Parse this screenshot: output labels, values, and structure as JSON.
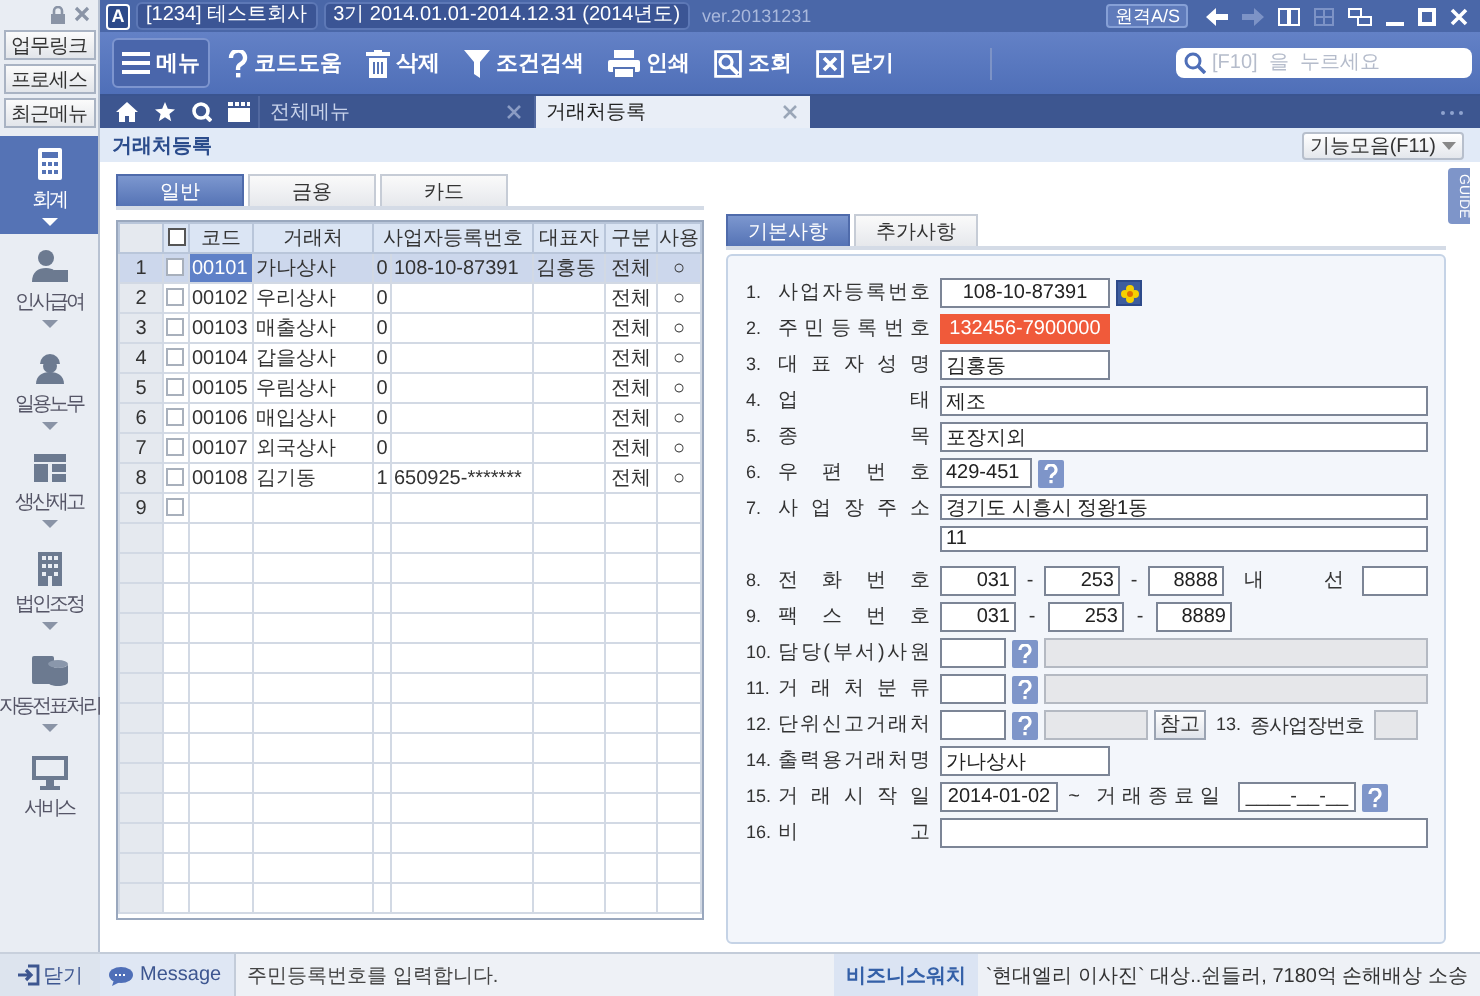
{
  "title_bar": {
    "app_icon": "A",
    "company": "[1234] 테스트회사",
    "period": "3기  2014.01.01-2014.12.31  (2014년도)",
    "version": "ver.20131231",
    "remote_button": "원격A/S"
  },
  "sidebar": {
    "quick_buttons": [
      "업무링크",
      "프로세스",
      "최근메뉴"
    ],
    "modules": [
      {
        "label": "회계",
        "kind": "calculator",
        "selected": true
      },
      {
        "label": "인사급여",
        "kind": "person",
        "selected": false
      },
      {
        "label": "일용노무",
        "kind": "worker",
        "selected": false
      },
      {
        "label": "생산재고",
        "kind": "blocks",
        "selected": false
      },
      {
        "label": "법인조정",
        "kind": "building",
        "selected": false
      },
      {
        "label": "자동전표처리",
        "kind": "database",
        "selected": false
      },
      {
        "label": "서비스",
        "kind": "monitor",
        "selected": false
      }
    ],
    "close_button": "닫기"
  },
  "toolbar": [
    {
      "label": "메뉴",
      "kind": "menu"
    },
    {
      "label": "코드도움",
      "kind": "help"
    },
    {
      "label": "삭제",
      "kind": "trash"
    },
    {
      "label": "조건검색",
      "kind": "filter"
    },
    {
      "label": "인쇄",
      "kind": "print"
    },
    {
      "label": "조회",
      "kind": "lookup"
    },
    {
      "label": "닫기",
      "kind": "close"
    }
  ],
  "search": {
    "placeholder": "[F10]  을  누르세요"
  },
  "tabs": [
    {
      "label": "전체메뉴",
      "selected": false
    },
    {
      "label": "거래처등록",
      "selected": true
    }
  ],
  "page": {
    "title": "거래처등록",
    "function_button": "기능모음(F11)",
    "guide_tab": "GUIDE"
  },
  "grid_tabs": [
    {
      "label": "일반",
      "selected": true
    },
    {
      "label": "금용",
      "selected": false
    },
    {
      "label": "카드",
      "selected": false
    }
  ],
  "table": {
    "header_checked": false,
    "columns": [
      "코드",
      "거래처",
      "사업자등록번호",
      "대표자",
      "구분",
      "사용"
    ],
    "rows": [
      {
        "num": "1",
        "checked": false,
        "selected": true,
        "code": "00101",
        "name": "가나상사",
        "flag": "0",
        "reg_no": "108-10-87391",
        "rep": "김홍동",
        "category": "전체",
        "use": "○"
      },
      {
        "num": "2",
        "checked": false,
        "selected": false,
        "code": "00102",
        "name": "우리상사",
        "flag": "0",
        "category": "전체",
        "use": "○"
      },
      {
        "num": "3",
        "checked": false,
        "selected": false,
        "code": "00103",
        "name": "매출상사",
        "flag": "0",
        "category": "전체",
        "use": "○"
      },
      {
        "num": "4",
        "checked": false,
        "selected": false,
        "code": "00104",
        "name": "갑을상사",
        "flag": "0",
        "category": "전체",
        "use": "○"
      },
      {
        "num": "5",
        "checked": false,
        "selected": false,
        "code": "00105",
        "name": "우림상사",
        "flag": "0",
        "category": "전체",
        "use": "○"
      },
      {
        "num": "6",
        "checked": false,
        "selected": false,
        "code": "00106",
        "name": "매입상사",
        "flag": "0",
        "category": "전체",
        "use": "○"
      },
      {
        "num": "7",
        "checked": false,
        "selected": false,
        "code": "00107",
        "name": "외국상사",
        "flag": "0",
        "category": "전체",
        "use": "○"
      },
      {
        "num": "8",
        "checked": false,
        "selected": false,
        "code": "00108",
        "name": "김기동",
        "flag": "1",
        "reg_no": "650925-*******",
        "category": "전체",
        "use": "○"
      },
      {
        "num": "9",
        "checked": false,
        "selected": false
      }
    ]
  },
  "form_tabs": [
    {
      "label": "기본사항",
      "selected": true
    },
    {
      "label": "추가사항",
      "selected": false
    }
  ],
  "form": {
    "fields": [
      {
        "num": "1.",
        "label": "사 업 자 등 록 번 호",
        "kind": "code_search",
        "value": "108-10-87391",
        "focused": false
      },
      {
        "num": "2.",
        "label": "주 민 등 록 번 호",
        "kind": "text",
        "value": "132456-7900000",
        "focused": true
      },
      {
        "num": "3.",
        "label": "대 표 자 성 명",
        "kind": "text",
        "value": "김홍동",
        "focused": false
      },
      {
        "num": "4.",
        "label": "업 태",
        "kind": "wide",
        "value": "제조"
      },
      {
        "num": "5.",
        "label": "종 목",
        "kind": "wide",
        "value": "포장지외"
      },
      {
        "num": "6.",
        "label": "우 편 번 호",
        "kind": "zip",
        "value": "429-451"
      },
      {
        "num": "7.",
        "label": "사 업 장 주 소",
        "kind": "address",
        "value": "경기도 시흥시 정왕1동",
        "value2": "11"
      },
      {
        "num": "8.",
        "label": "전 화 번 호",
        "kind": "phone",
        "parts": [
          "031",
          "253",
          "8888"
        ],
        "separator": "-",
        "ext_label": "내 선"
      },
      {
        "num": "9.",
        "label": "팩 스 번 호",
        "kind": "phone",
        "parts": [
          "031",
          "253",
          "8889"
        ],
        "separator": "-"
      },
      {
        "num": "10.",
        "label": "담 당 ( 부 서 ) 사 원",
        "kind": "lookup"
      },
      {
        "num": "11.",
        "label": "거 래 처 분 류",
        "kind": "lookup"
      },
      {
        "num": "12.",
        "label": "단 위 신 고 거 래 처",
        "kind": "lookup",
        "ref_button": "참고",
        "extra_num": "13.",
        "extra_label": "종사업장번호"
      },
      {
        "num": "14.",
        "label": "출 력 용 거 래 처 명",
        "kind": "text",
        "value": "가나상사",
        "focused": false
      },
      {
        "num": "15.",
        "label": "거 래 시 작 일",
        "kind": "date_range",
        "value": "2014-01-02",
        "range_sep": "~",
        "end_label": "거 래 종 료 일",
        "end_placeholder": "____-__-__"
      },
      {
        "num": "16.",
        "label": "비 고",
        "kind": "wide"
      }
    ]
  },
  "status_bar": {
    "message_label": "Message",
    "message": "주민등록번호를 입력합니다.",
    "news_label": "비즈니스워치",
    "news": "`현대엘리 이사진` 대상..쉰들러, 7180억 손해배상 소송"
  }
}
